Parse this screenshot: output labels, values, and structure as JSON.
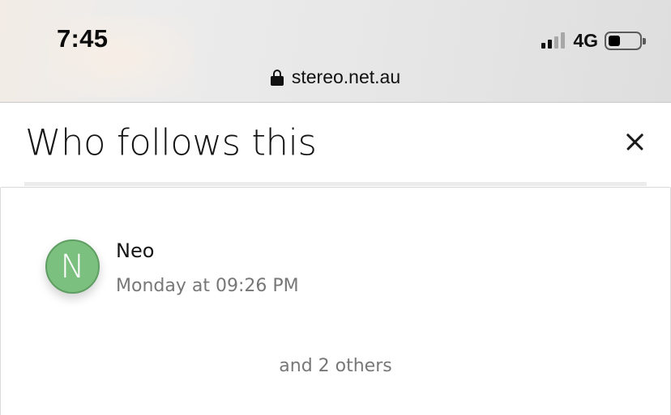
{
  "status_bar": {
    "time": "7:45",
    "network": "4G",
    "signal_bars_active": 2,
    "signal_bars_total": 4
  },
  "address_bar": {
    "domain": "stereo.net.au",
    "secure_icon": "lock-icon"
  },
  "dialog": {
    "title": "Who follows this",
    "close_icon": "close-icon"
  },
  "followers": [
    {
      "initial": "N",
      "name": "Neo",
      "timestamp": "Monday at 09:26 PM",
      "avatar_color": "#7cc07f"
    }
  ],
  "others_text": "and 2 others"
}
